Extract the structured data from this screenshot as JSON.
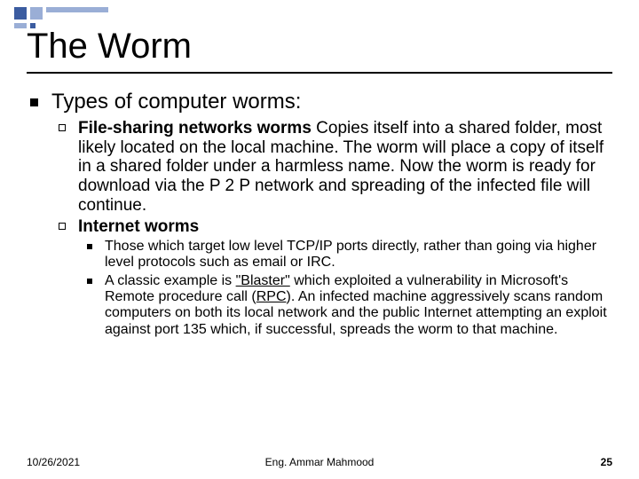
{
  "title": "The Worm",
  "level1_text": "Types of computer worms:",
  "item1": {
    "bold_lead": "File-sharing networks worms",
    "rest": " Copies itself into a shared folder, most likely located on the local machine. The worm will place a copy of itself in a shared folder under a harmless name. Now the worm is ready for download via the P 2 P network and spreading of the infected file will continue."
  },
  "item2": {
    "bold_lead": "Internet worms"
  },
  "sub1": "Those which target low level TCP/IP ports directly, rather than going via higher level protocols such as email or IRC.",
  "sub2": {
    "pre": "A classic example is ",
    "blaster": "\"Blaster\"",
    "mid": " which exploited a vulnerability in Microsoft's Remote procedure call (",
    "rpc": "RPC",
    "post": "). An infected machine aggressively scans random computers on both its local network and the public Internet attempting an exploit against port 135 which, if successful, spreads the worm to that machine."
  },
  "footer": {
    "date": "10/26/2021",
    "center": "Eng. Ammar Mahmood",
    "page": "25"
  }
}
